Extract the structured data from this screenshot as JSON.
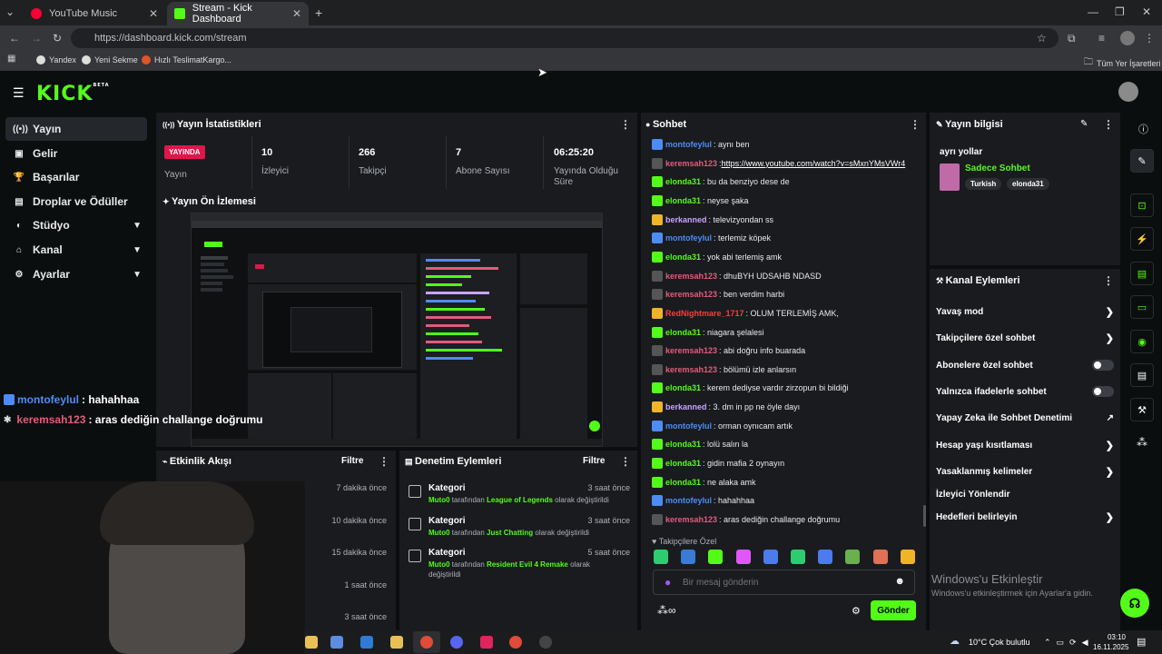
{
  "browser": {
    "tabs": [
      {
        "label": "YouTube Music"
      },
      {
        "label": "Stream - Kick Dashboard"
      }
    ],
    "url": "https://dashboard.kick.com/stream",
    "bookmarks": [
      {
        "label": "Yandex"
      },
      {
        "label": "Yeni Sekme"
      },
      {
        "label": "Hızlı TeslimatKargo..."
      }
    ],
    "all_bookmarks": "Tüm Yer İşaretleri"
  },
  "brand": {
    "logo": "KICK",
    "beta": "BETA",
    "accent": "#53fc18"
  },
  "sidebar": {
    "items": [
      {
        "label": "Yayın",
        "icon": "broadcast-icon"
      },
      {
        "label": "Gelir",
        "icon": "money-icon"
      },
      {
        "label": "Başarılar",
        "icon": "trophy-icon"
      },
      {
        "label": "Droplar ve Ödüller",
        "icon": "gift-icon"
      },
      {
        "label": "Stüdyo",
        "icon": "studio-icon"
      },
      {
        "label": "Kanal",
        "icon": "channel-icon"
      },
      {
        "label": "Ayarlar",
        "icon": "gear-icon"
      }
    ]
  },
  "stats": {
    "title": "Yayın İstatistikleri",
    "live_badge": "YAYINDA",
    "live_label": "Yayın",
    "viewers": {
      "value": "10",
      "label": "İzleyici"
    },
    "followers": {
      "value": "266",
      "label": "Takipçi"
    },
    "subs": {
      "value": "7",
      "label": "Abone Sayısı"
    },
    "uptime": {
      "value": "06:25:20",
      "label": "Yayında Olduğu Süre"
    }
  },
  "preview": {
    "title": "Yayın Ön İzlemesi"
  },
  "overlay_chat": [
    {
      "user": "montofeylul",
      "msg": ": hahahhaa",
      "color": "#4d8cf5"
    },
    {
      "user": "keremsah123",
      "msg": ": aras dediğin challange doğrumu",
      "color": "#e35c7a"
    }
  ],
  "activity": {
    "title": "Etkinlik Akışı",
    "filter": "Filtre",
    "times": [
      "7 dakika önce",
      "10 dakika önce",
      "15 dakika önce",
      "1 saat önce",
      "3 saat önce"
    ]
  },
  "moderation": {
    "title": "Denetim Eylemleri",
    "filter": "Filtre",
    "entries": [
      {
        "title": "Kategori",
        "time": "3 saat önce",
        "user": "Muto0",
        "mid": " tarafından ",
        "target": "League of Legends",
        "tail": " olarak değiştirildi"
      },
      {
        "title": "Kategori",
        "time": "3 saat önce",
        "user": "Muto0",
        "mid": " tarafından ",
        "target": "Just Chatting",
        "tail": " olarak değiştirildi"
      },
      {
        "title": "Kategori",
        "time": "5 saat önce",
        "user": "Muto0",
        "mid": " tarafından ",
        "target": "Resident Evil 4 Remake",
        "tail": " olarak değiştirildi"
      }
    ]
  },
  "chat": {
    "title": "Sohbet",
    "messages": [
      {
        "user": "montofeylul",
        "msg": ": aynı ben",
        "color": "#4d8cf5"
      },
      {
        "user": "keremsah123",
        "msg": ": ",
        "link": "https://www.youtube.com/watch?v=sMxnYMsVWr4",
        "color": "#e35c7a"
      },
      {
        "user": "elonda31",
        "msg": ": bu da benziyo dese de",
        "color": "#53fc18"
      },
      {
        "user": "elonda31",
        "msg": ": neyse şaka",
        "color": "#53fc18"
      },
      {
        "user": "berkanned",
        "msg": ": televizyondan ss",
        "color": "#c9a3ff"
      },
      {
        "user": "montofeylul",
        "msg": ": terlemiz köpek",
        "color": "#4d8cf5"
      },
      {
        "user": "elonda31",
        "msg": ": yok abi terlemiş amk",
        "color": "#53fc18"
      },
      {
        "user": "keremsah123",
        "msg": ": dhuBYH UDSAHB NDASD",
        "color": "#e35c7a"
      },
      {
        "user": "keremsah123",
        "msg": ": ben verdim harbi",
        "color": "#e35c7a"
      },
      {
        "user": "RedNightmare_1717",
        "msg": ": OLUM TERLEMİŞ AMK,",
        "color": "#ff3b3b"
      },
      {
        "user": "elonda31",
        "msg": ": niagara şelalesi",
        "color": "#53fc18"
      },
      {
        "user": "keremsah123",
        "msg": ": abi doğru info buarada",
        "color": "#e35c7a"
      },
      {
        "user": "keremsah123",
        "msg": ": bölümü izle anlarsın",
        "color": "#e35c7a"
      },
      {
        "user": "elonda31",
        "msg": ": kerem dediyse vardır zirzopun bi bildiği",
        "color": "#53fc18"
      },
      {
        "user": "berkanned",
        "msg": ": 3. dm in pp ne öyle dayı",
        "color": "#c9a3ff"
      },
      {
        "user": "montofeylul",
        "msg": ": orman oynıcam artık",
        "color": "#4d8cf5"
      },
      {
        "user": "elonda31",
        "msg": ": lolü salın la",
        "color": "#53fc18"
      },
      {
        "user": "elonda31",
        "msg": ": gidin mafia 2 oynayın",
        "color": "#53fc18"
      },
      {
        "user": "elonda31",
        "msg": ": ne alaka amk",
        "color": "#53fc18"
      },
      {
        "user": "montofeylul",
        "msg": ": hahahhaa",
        "color": "#4d8cf5"
      },
      {
        "user": "keremsah123",
        "msg": ": aras dediğin challange doğrumu",
        "color": "#e35c7a"
      }
    ],
    "followers_only": "Takipçilere Özel",
    "placeholder": "Bir mesaj gönderin",
    "send": "Gönder"
  },
  "stream_info": {
    "title": "Yayın bilgisi",
    "stream_title": "ayrı yollar",
    "category": "Sadece Sohbet",
    "tags": [
      "Turkish",
      "elonda31"
    ]
  },
  "channel_actions": {
    "title": "Kanal Eylemleri",
    "items": [
      {
        "label": "Yavaş mod",
        "type": "chevron"
      },
      {
        "label": "Takipçilere özel sohbet",
        "type": "chevron"
      },
      {
        "label": "Abonelere özel sohbet",
        "type": "toggle"
      },
      {
        "label": "Yalnızca ifadelerle sohbet",
        "type": "toggle"
      },
      {
        "label": "Yapay Zeka ile Sohbet Denetimi",
        "type": "external"
      },
      {
        "label": "Hesap yaşı kısıtlaması",
        "type": "chevron"
      },
      {
        "label": "Yasaklanmış kelimeler",
        "type": "chevron"
      },
      {
        "label": "İzleyici Yönlendir",
        "type": "none"
      },
      {
        "label": "Hedefleri belirleyin",
        "type": "chevron"
      }
    ]
  },
  "windows": {
    "activate_title": "Windows'u Etkinleştir",
    "activate_sub": "Windows'u etkinleştirmek için Ayarlar'a gidin."
  },
  "taskbar": {
    "weather": "10°C  Çok bulutlu",
    "time": "03:10",
    "date": "16.11.2025"
  }
}
